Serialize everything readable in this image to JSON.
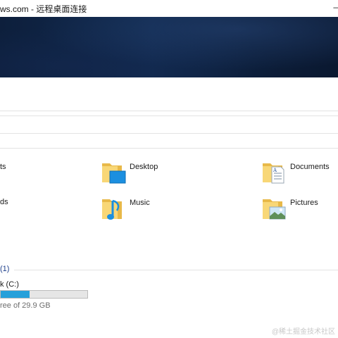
{
  "window": {
    "title": "ws.com - 远程桌面连接",
    "control_glyph": "–"
  },
  "quick_access": {
    "partial_items": [
      {
        "label": "ts"
      },
      {
        "label": "ds"
      }
    ],
    "folders": [
      {
        "label": "Desktop",
        "icon": "desktop-folder-icon"
      },
      {
        "label": "Documents",
        "icon": "documents-folder-icon"
      },
      {
        "label": "Music",
        "icon": "music-folder-icon"
      },
      {
        "label": "Pictures",
        "icon": "pictures-folder-icon"
      }
    ]
  },
  "devices": {
    "count_label": "(1)",
    "drive": {
      "name": "k (C:)",
      "free_text": "ree of 29.9 GB",
      "used_fraction": 0.33
    }
  },
  "colors": {
    "accent": "#26a0da",
    "folder_body": "#f8d777",
    "folder_back": "#e8b949",
    "section_blue": "#1e3f8b"
  },
  "watermark": "@稀土掘金技术社区"
}
